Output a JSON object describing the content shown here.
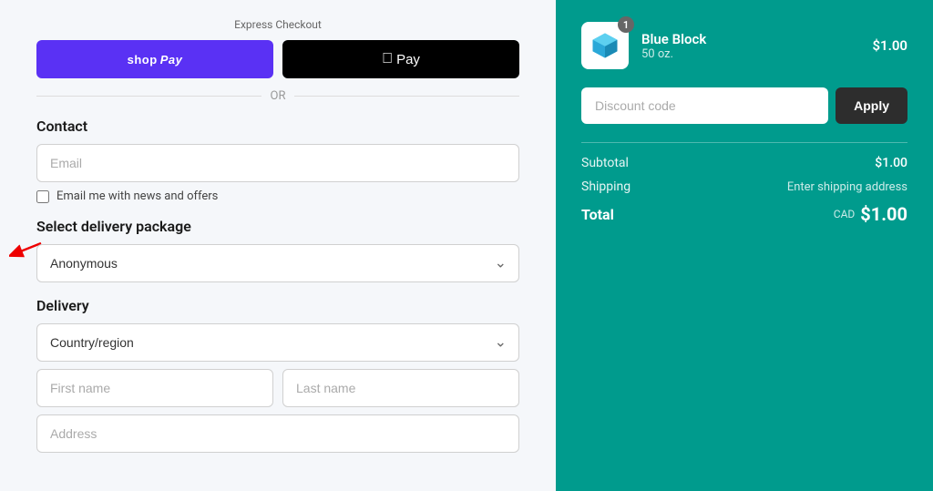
{
  "left": {
    "express_checkout_label": "Express Checkout",
    "shop_pay_label": "shop",
    "shop_pay_suffix": "Pay",
    "apple_pay_label": " Pay",
    "or_text": "OR",
    "contact_section": {
      "title": "Contact",
      "email_placeholder": "Email",
      "newsletter_label": "Email me with news and offers"
    },
    "delivery_package_section": {
      "title": "Select delivery package",
      "options": [
        "Anonymous"
      ],
      "selected": "Anonymous"
    },
    "delivery_section": {
      "title": "Delivery",
      "country_placeholder": "Country/region",
      "first_name_placeholder": "First name",
      "last_name_placeholder": "Last name",
      "address_placeholder": "Address"
    }
  },
  "right": {
    "product": {
      "name": "Blue Block",
      "description": "50 oz.",
      "price": "$1.00",
      "quantity": "1"
    },
    "discount": {
      "placeholder": "Discount code",
      "apply_label": "Apply"
    },
    "summary": {
      "subtotal_label": "Subtotal",
      "subtotal_value": "$1.00",
      "shipping_label": "Shipping",
      "shipping_value": "Enter shipping address",
      "total_label": "Total",
      "total_currency": "CAD",
      "total_value": "$1.00"
    }
  }
}
